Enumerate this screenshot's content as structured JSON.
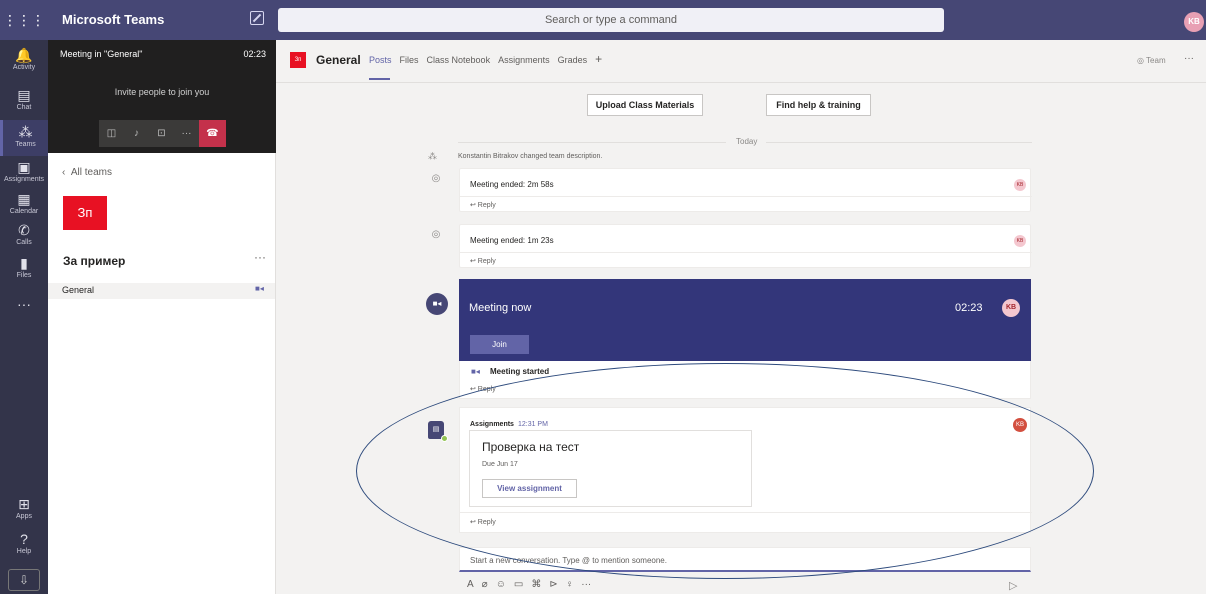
{
  "topbar": {
    "app_title": "Microsoft Teams",
    "search_placeholder": "Search or type a command",
    "user_initials": "KB",
    "waffle": "⋮⋮⋮"
  },
  "rail": [
    {
      "label": "Activity",
      "icon": "🔔"
    },
    {
      "label": "Chat",
      "icon": "▤"
    },
    {
      "label": "Teams",
      "icon": "⁂"
    },
    {
      "label": "Assignments",
      "icon": "▣"
    },
    {
      "label": "Calendar",
      "icon": "▦"
    },
    {
      "label": "Calls",
      "icon": "✆"
    },
    {
      "label": "Files",
      "icon": "▮"
    },
    {
      "label": "",
      "icon": "···"
    }
  ],
  "rail_bottom": [
    {
      "label": "Apps",
      "icon": "⊞"
    },
    {
      "label": "Help",
      "icon": "?"
    }
  ],
  "call": {
    "title": "Meeting in \"General\"",
    "time": "02:23",
    "invite": "Invite people to join you"
  },
  "sidebar": {
    "all_teams": "All teams",
    "team_tile": "Зп",
    "team_name": "За пример",
    "more": "···",
    "channel": "General"
  },
  "channel_header": {
    "tile": "Зп",
    "name": "General",
    "tabs": [
      "Posts",
      "Files",
      "Class Notebook",
      "Assignments",
      "Grades",
      "+"
    ],
    "team_button": "◎ Team",
    "more": "···"
  },
  "feed": {
    "upload_button": "Upload Class Materials",
    "help_button": "Find help & training",
    "today": "Today",
    "system_message": "Konstantin Bitrakov changed team description.",
    "posts": [
      {
        "title": "Meeting ended: 2m 58s",
        "reply": "↩ Reply",
        "avatar": "KB"
      },
      {
        "title": "Meeting ended: 1m 23s",
        "reply": "↩ Reply",
        "avatar": "KB"
      }
    ],
    "meeting_now": {
      "title": "Meeting now",
      "time": "02:23",
      "avatar": "KB",
      "join": "Join",
      "started": "Meeting started",
      "reply": "↩ Reply"
    },
    "assignment_post": {
      "author": "Assignments",
      "time": "12:31 PM",
      "card_title": "Проверка на тест",
      "due": "Due Jun 17",
      "button": "View assignment",
      "reply": "↩ Reply"
    },
    "compose_placeholder": "Start a new conversation. Type @ to mention someone.",
    "toolbar": [
      "A",
      "⌀",
      "☺",
      "▭",
      "⌘",
      "⊳",
      "♀",
      "···"
    ],
    "send": "▷"
  }
}
